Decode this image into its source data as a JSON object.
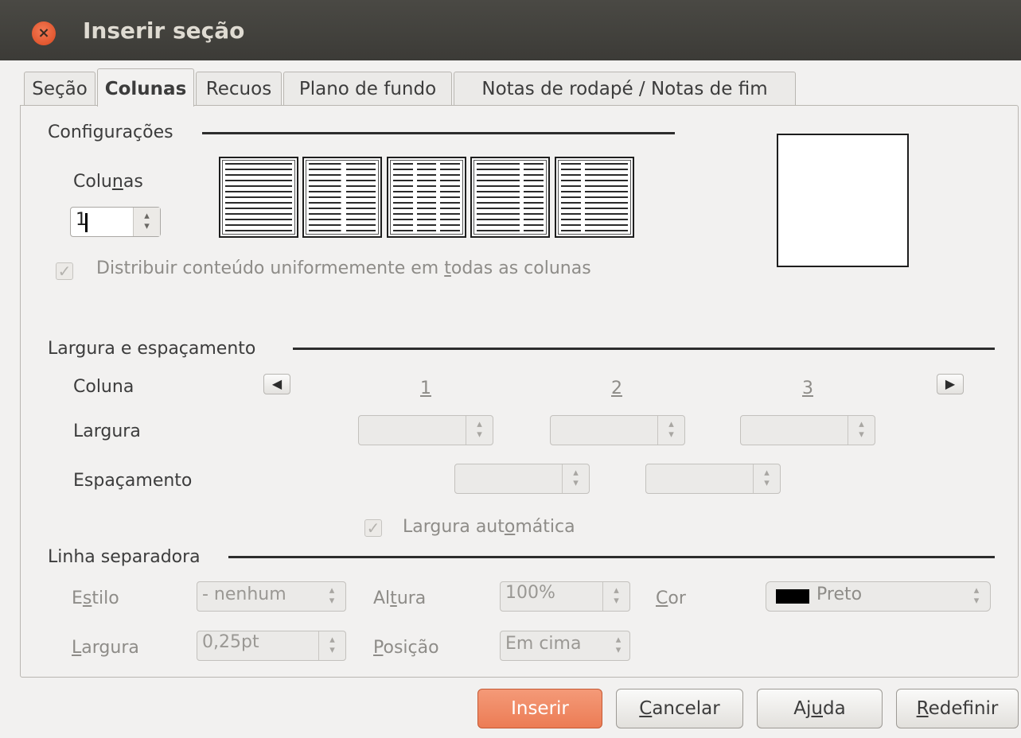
{
  "window": {
    "title": "Inserir seção",
    "close_icon": "close-icon"
  },
  "tabs": [
    {
      "label": "Seção",
      "active": false
    },
    {
      "label": "Colunas",
      "active": true
    },
    {
      "label": "Recuos",
      "active": false
    },
    {
      "label": "Plano de fundo",
      "active": false
    },
    {
      "label": "Notas de rodapé / Notas de fim",
      "active": false
    }
  ],
  "settings": {
    "title": "Configurações",
    "columns_label": {
      "pre": "Colu",
      "u": "n",
      "post": "as"
    },
    "columns_value": "1",
    "distribute": {
      "pre": "Distribuir conteúdo uniformemente em ",
      "u": "t",
      "post": "odas as colunas",
      "checked": true,
      "enabled": false
    }
  },
  "width_spacing": {
    "title": "Largura e espaçamento",
    "column_label": "Coluna",
    "width_label": "Largura",
    "spacing_label": "Espaçamento",
    "column_numbers": [
      "1",
      "2",
      "3"
    ],
    "auto_width": {
      "pre": "Largura aut",
      "u": "o",
      "post": "mática",
      "checked": true,
      "enabled": false
    }
  },
  "separator": {
    "title": "Linha separadora",
    "style": {
      "pre": "E",
      "u": "s",
      "post": "tilo",
      "value": "- nenhum"
    },
    "height": {
      "pre": "Al",
      "u": "t",
      "post": "ura",
      "value": "100%"
    },
    "color": {
      "pre": "",
      "u": "C",
      "post": "or",
      "value": "Preto",
      "swatch": "#000000"
    },
    "width": {
      "pre": "",
      "u": "L",
      "post": "argura",
      "value": "0,25pt"
    },
    "position": {
      "pre": "",
      "u": "P",
      "post": "osição",
      "value": "Em cima"
    }
  },
  "buttons": {
    "insert": "Inserir",
    "cancel": {
      "pre": "",
      "u": "C",
      "post": "ancelar"
    },
    "help": {
      "pre": "Aj",
      "u": "u",
      "post": "da"
    },
    "reset": {
      "pre": "",
      "u": "R",
      "post": "edefinir"
    }
  },
  "colors": {
    "accent": "#ec7c55",
    "titlebar": "#3c3b37"
  }
}
